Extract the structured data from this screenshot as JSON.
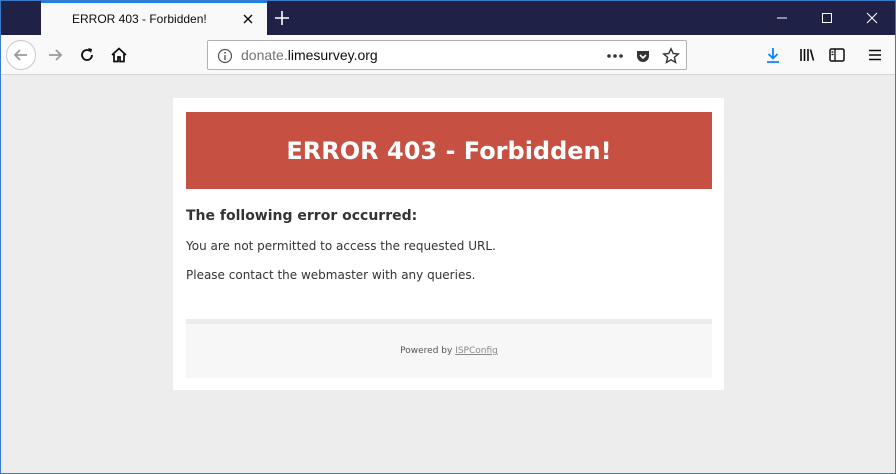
{
  "browser": {
    "tab": {
      "title": "ERROR 403 - Forbidden!"
    },
    "url": {
      "prefix": "donate.",
      "domain": "limesurvey.org"
    },
    "colors": {
      "titlebar": "#1f2246",
      "accent": "#0a84ff",
      "download": "#0a84ff"
    }
  },
  "page": {
    "error_title": "ERROR 403 - Forbidden!",
    "heading": "The following error occurred:",
    "message_1": "You are not permitted to access the requested URL.",
    "message_2": "Please contact the webmaster with any queries.",
    "footer": {
      "powered_by": "Powered by ",
      "link_text": "ISPConfig"
    },
    "colors": {
      "banner": "#c65142"
    }
  }
}
